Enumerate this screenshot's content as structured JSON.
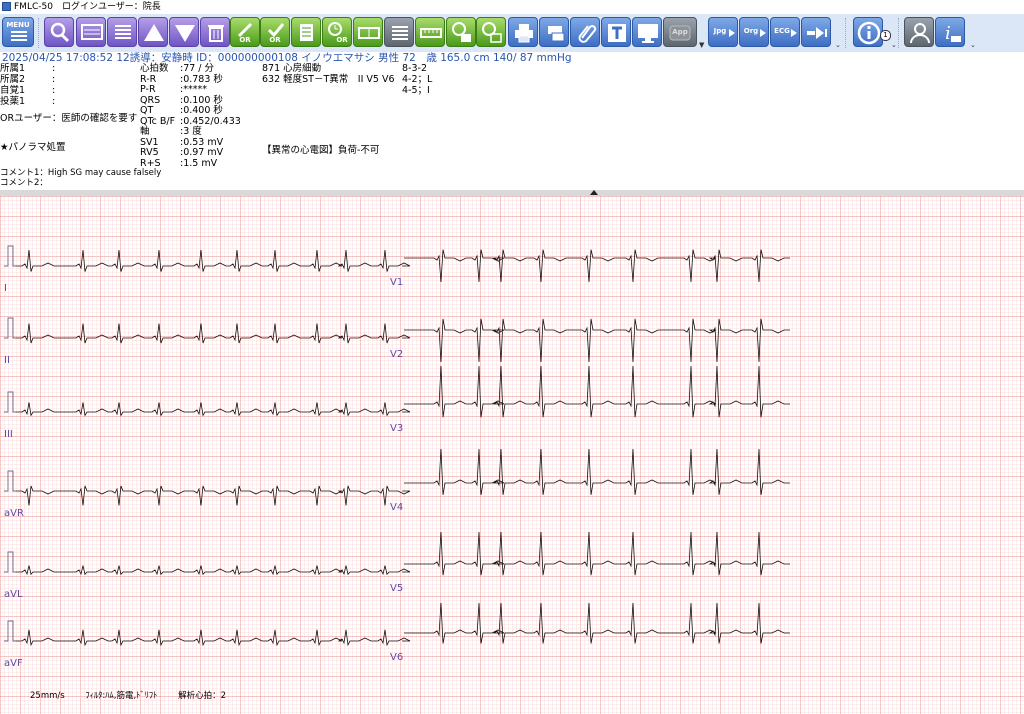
{
  "window": {
    "title": "FMLC-50　ログインユーザー：院長"
  },
  "toolbar": {
    "menu_label": "MENU",
    "order_label_1": "OR",
    "order_label_2": "OR",
    "order_label_3": "OR",
    "app_label": "App",
    "jpg_label": "Jpg",
    "org_label": "Org",
    "ecg_label": "ECG",
    "info_count": "1"
  },
  "patient_line": {
    "datetime": "2025/04/25 17:08:52",
    "lead_mode": "12誘導：安静時",
    "id": "ID：000000000108",
    "name": "イノウエマサシ",
    "sex": "男性",
    "age": "72　歳",
    "height": "165.0 cm",
    "bp": "140/ 87 mmHg"
  },
  "fields": {
    "labels": [
      "所属1",
      "所属2",
      "自覚1",
      "投薬1"
    ],
    "colons": [
      ":",
      ":",
      ":",
      ":"
    ],
    "or_user": "ORユーザー：医師の確認を要す",
    "panorama": "★パノラマ処置",
    "comment1": "コメント1：High SG may cause falsely",
    "comment2": "コメント2："
  },
  "measurements": [
    {
      "label": "心拍数",
      "value": ":77 / 分"
    },
    {
      "label": "R-R",
      "value": ":0.783 秒"
    },
    {
      "label": "P-R",
      "value": ":*****"
    },
    {
      "label": "QRS",
      "value": ":0.100 秒"
    },
    {
      "label": "QT",
      "value": ":0.400 秒"
    },
    {
      "label": "QTc B/F",
      "value": ":0.452/0.433"
    },
    {
      "label": "軸",
      "value": ":3 度"
    },
    {
      "label": "SV1",
      "value": ":0.53 mV"
    },
    {
      "label": "RV5",
      "value": ":0.97 mV"
    },
    {
      "label": "R+S",
      "value": ":1.5 mV"
    }
  ],
  "findings": [
    {
      "text": "871 心房細動",
      "code": "8-3-2"
    },
    {
      "text": "632 軽度ST－T異常　II V5 V6",
      "code": "4-2；L"
    },
    {
      "text": "",
      "code": "4-5；I"
    }
  ],
  "judgement": "【異常の心電図】負荷-不可",
  "leads": {
    "left": [
      "I",
      "II",
      "III",
      "aVR",
      "aVL",
      "aVF"
    ],
    "right": [
      "V1",
      "V2",
      "V3",
      "V4",
      "V5",
      "V6"
    ]
  },
  "footer": {
    "speed": "25mm/s",
    "filter": "ﾌｨﾙﾀ:ﾊﾑ,筋電,ﾄﾞﾘﾌﾄ",
    "beats": "解析心拍：2"
  },
  "colors": {
    "grid_minor": "#f7c6c6",
    "grid_major": "#ee8f8f",
    "trace": "#111111",
    "toolbar_bg": "#dbe7f7"
  }
}
